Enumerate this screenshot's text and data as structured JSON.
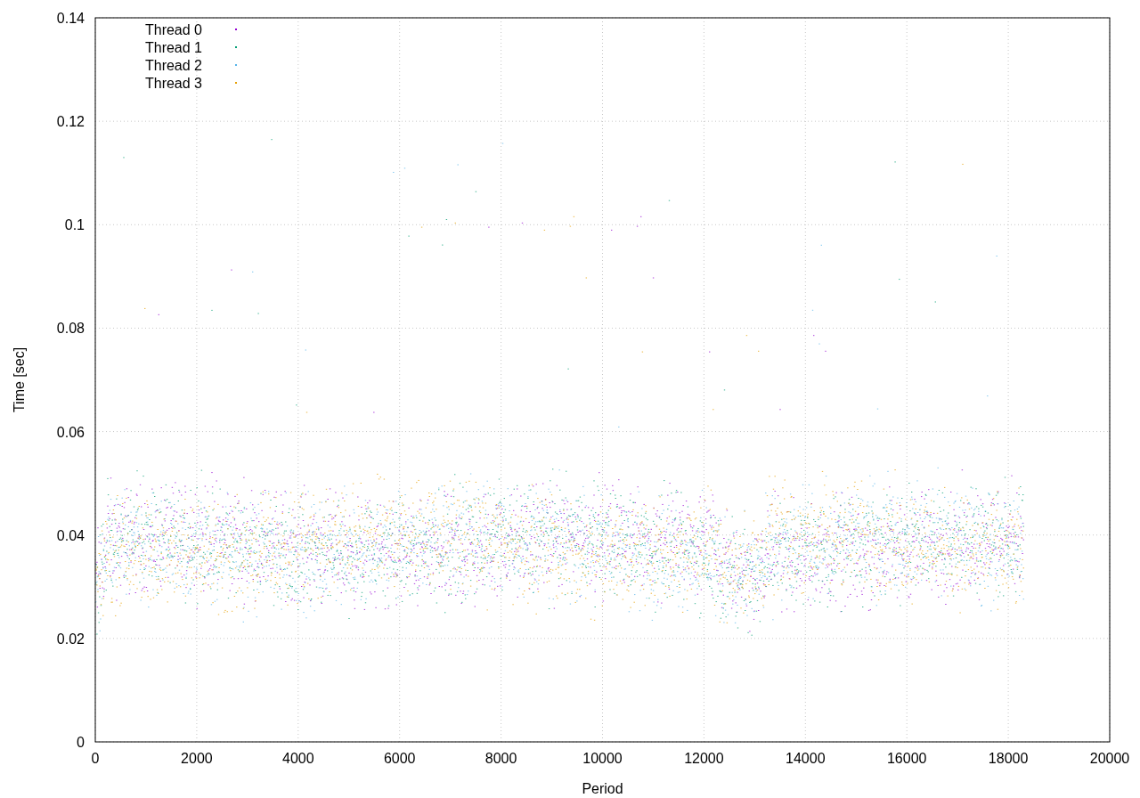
{
  "plot": {
    "y_axis_label": "Time [sec]",
    "x_axis_label": "Period",
    "x_tick_labels": [
      "0",
      "2000",
      "4000",
      "6000",
      "8000",
      "10000",
      "12000",
      "14000",
      "16000",
      "18000",
      "20000"
    ],
    "y_tick_labels": [
      "0.14",
      "0.12",
      "0.1",
      "0.08",
      "0.06",
      "0.04",
      "0.02",
      "0"
    ],
    "legend": [
      {
        "label": "Thread 0",
        "color": "#9400d3"
      },
      {
        "label": "Thread 1",
        "color": "#009e73"
      },
      {
        "label": "Thread 2",
        "color": "#56b4e9"
      },
      {
        "label": "Thread 3",
        "color": "#e69f00"
      }
    ]
  }
}
